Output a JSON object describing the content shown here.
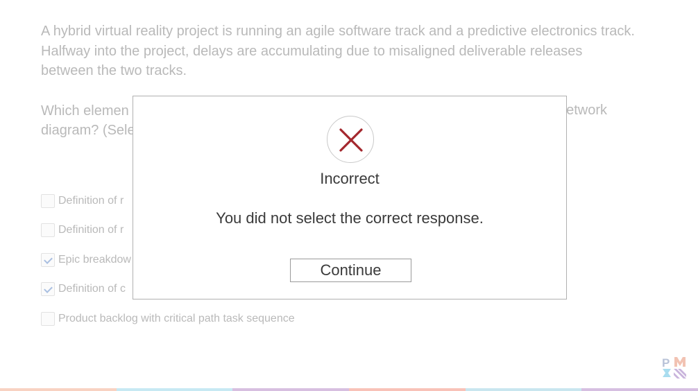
{
  "question": {
    "paragraph1": "A hybrid virtual reality project is running an agile software track and a predictive electronics track. Halfway into the project, delays are accumulating due to misaligned deliverable releases between the two tracks.",
    "paragraph2_line1_left": "Which elemen",
    "paragraph2_line1_right": "network",
    "paragraph2_line2_left": "diagram? (Sele"
  },
  "options": [
    {
      "label": "Definition of r",
      "checked": false
    },
    {
      "label": "Definition of r",
      "checked": false
    },
    {
      "label": "Epic breakdow",
      "checked": true
    },
    {
      "label": "Definition of c",
      "checked": true
    },
    {
      "label": "Product backlog with critical path task sequence",
      "checked": false
    }
  ],
  "modal": {
    "icon": "x-mark-icon",
    "title": "Incorrect",
    "message": "You did not select the correct response.",
    "button_label": "Continue",
    "icon_color": "#a3272d"
  },
  "logo": {
    "text": "PMI"
  },
  "bottom_bar_colors": [
    "#f8d2c2",
    "#c7e9f3",
    "#d7bfe0",
    "#f8c2b8",
    "#c9e6ef",
    "#d6bfe1"
  ]
}
